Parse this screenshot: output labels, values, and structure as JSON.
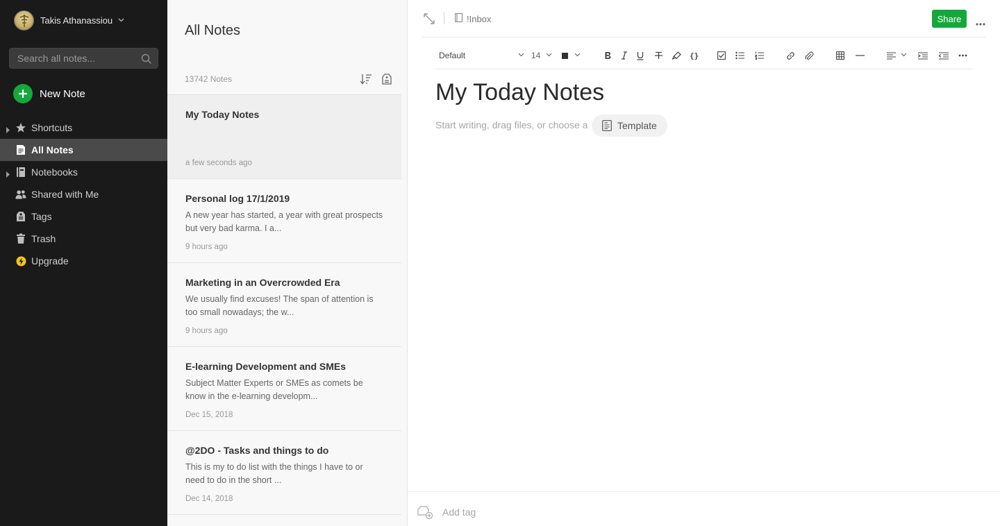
{
  "sidebar": {
    "account_name": "Takis Athanassiou",
    "search_placeholder": "Search all notes...",
    "new_note_label": "New Note",
    "items": [
      {
        "label": "Shortcuts",
        "icon": "star-icon"
      },
      {
        "label": "All Notes",
        "icon": "note-icon"
      },
      {
        "label": "Notebooks",
        "icon": "notebook-icon"
      },
      {
        "label": "Shared with Me",
        "icon": "people-icon"
      },
      {
        "label": "Tags",
        "icon": "tag-icon"
      },
      {
        "label": "Trash",
        "icon": "trash-icon"
      },
      {
        "label": "Upgrade",
        "icon": "upgrade-icon"
      }
    ]
  },
  "note_list": {
    "title": "All Notes",
    "count": "13742 Notes",
    "notes": [
      {
        "title": "My Today Notes",
        "snippet": "",
        "date": "a few seconds ago"
      },
      {
        "title": "Personal log 17/1/2019",
        "snippet": "A new year has started, a year with great prospects but very bad karma. I a...",
        "date": "9 hours ago"
      },
      {
        "title": "Marketing in an Overcrowded Era",
        "snippet": "We usually find excuses! The span of attention is too small nowadays; the w...",
        "date": "9 hours ago"
      },
      {
        "title": "E-learning Development and SMEs",
        "snippet": "Subject Matter Experts or SMEs as comets be know in the e-learning developm...",
        "date": "Dec 15, 2018"
      },
      {
        "title": "@2DO - Tasks and things to do",
        "snippet": "This is my to do list with the things I have to or need to do in the short ...",
        "date": "Dec 14, 2018"
      }
    ]
  },
  "editor": {
    "notebook": "!Inbox",
    "share_label": "Share",
    "font_family": "Default",
    "font_size": "14",
    "note_title": "My Today Notes",
    "placeholder_text": "Start writing, drag files, or choose a",
    "template_label": "Template",
    "add_tag_placeholder": "Add tag"
  },
  "colors": {
    "accent_green": "#14a83c",
    "sidebar_bg": "#1a1a1a",
    "sidebar_active": "#4a4a4a",
    "upgrade_yellow": "#f5c518"
  }
}
